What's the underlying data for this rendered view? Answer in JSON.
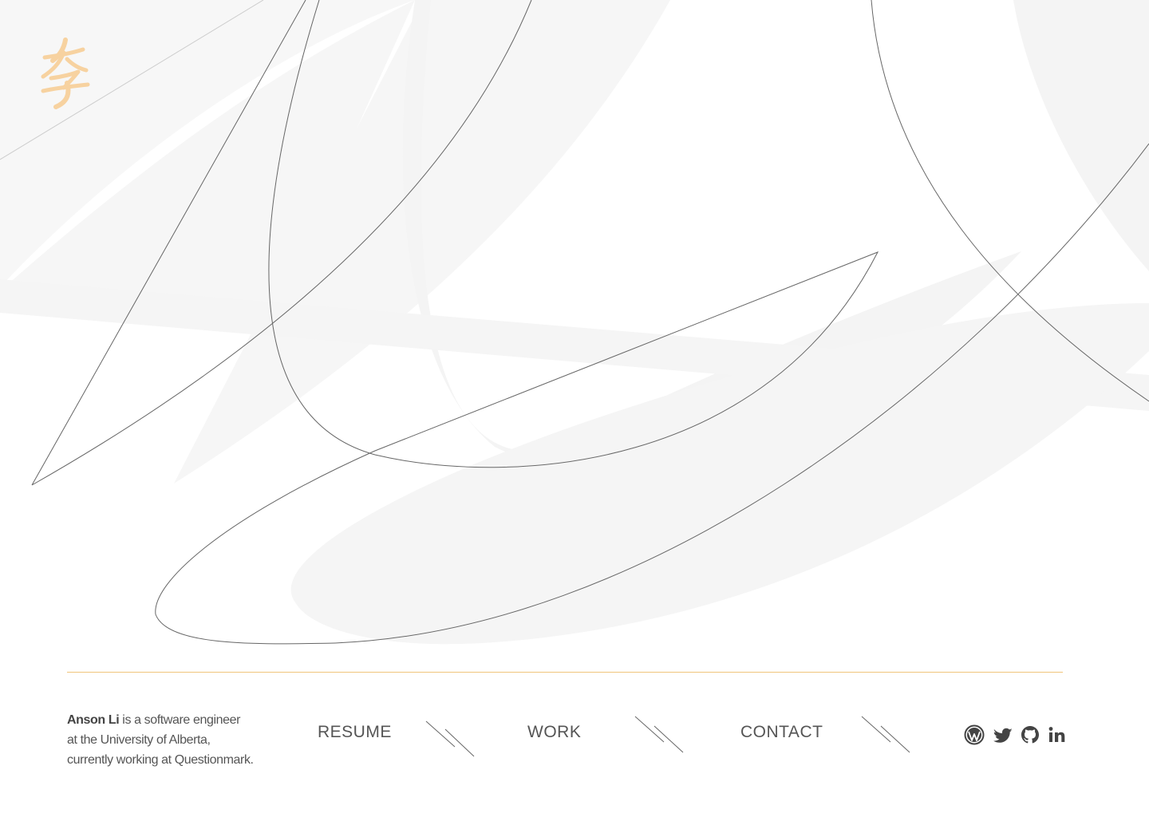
{
  "logo": {
    "icon": "li-calligraphy-logo-icon",
    "color": "#f7d2a0"
  },
  "bio": {
    "name": "Anson Li",
    "connector": "is a",
    "role": "software engineer",
    "line2": "at the University of Alberta,",
    "line3": "currently working at Questionmark."
  },
  "nav": {
    "resume": "RESUME",
    "work": "WORK",
    "contact": "CONTACT"
  },
  "socials": [
    {
      "name": "wordpress",
      "icon": "wordpress-icon"
    },
    {
      "name": "twitter",
      "icon": "twitter-icon"
    },
    {
      "name": "github",
      "icon": "github-icon"
    },
    {
      "name": "linkedin",
      "icon": "linkedin-icon"
    }
  ],
  "colors": {
    "accent": "#f0c47c",
    "highlight": "#f5c98a",
    "text": "#555555",
    "shape": "#f5f5f5",
    "stroke": "#666666"
  }
}
